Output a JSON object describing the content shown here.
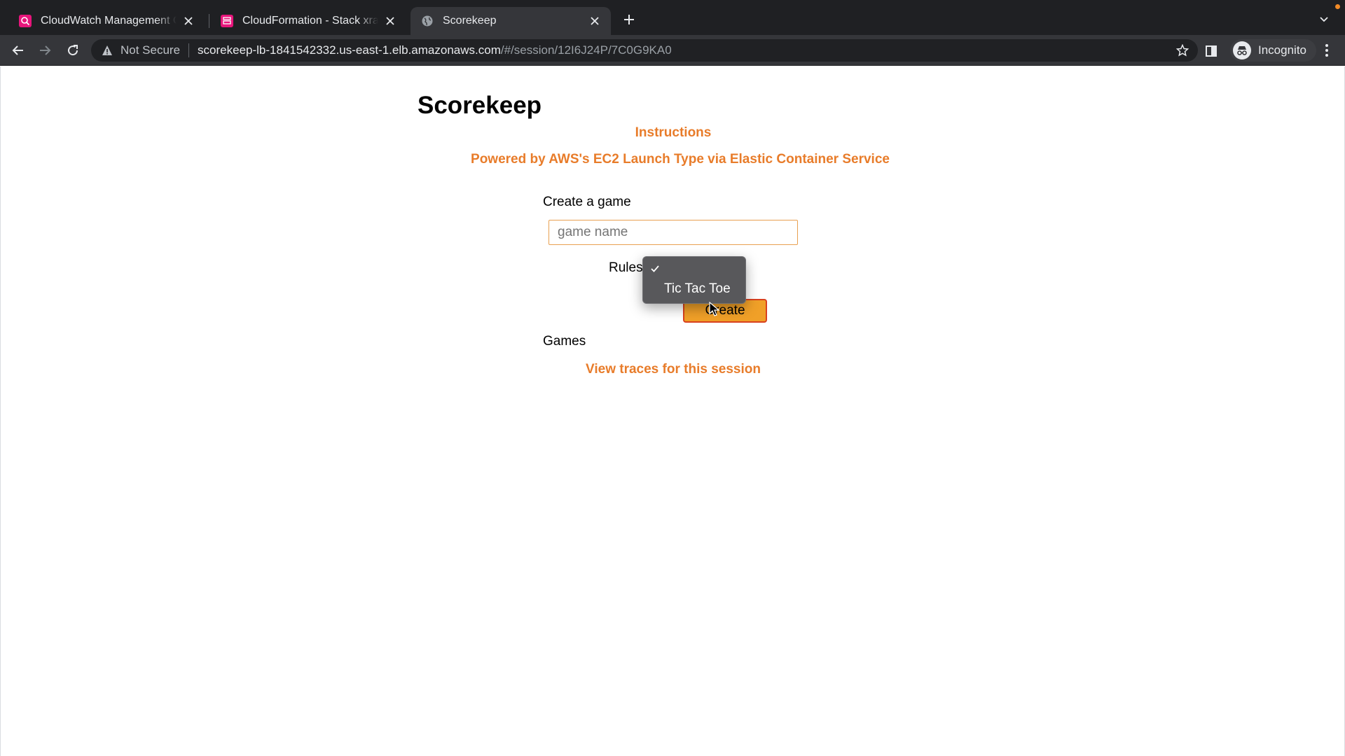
{
  "browser": {
    "tabs": [
      {
        "title": "CloudWatch Management Console",
        "active": false,
        "favicon": "cloudwatch-icon",
        "color": "#e7157b"
      },
      {
        "title": "CloudFormation - Stack xray-scorekeep",
        "active": false,
        "favicon": "cloudformation-icon",
        "color": "#e7157b"
      },
      {
        "title": "Scorekeep",
        "active": true,
        "favicon": "globe-icon"
      }
    ],
    "address": {
      "security_label": "Not Secure",
      "host": "scorekeep-lb-1841542332.us-east-1.elb.amazonaws.com",
      "path": "/#/session/12I6J24P/7C0G9KA0"
    },
    "profile_label": "Incognito"
  },
  "page": {
    "title": "Scorekeep",
    "instructions_link": "Instructions",
    "powered_by_link": "Powered by AWS's EC2 Launch Type via Elastic Container Service",
    "create_game_label": "Create a game",
    "game_name_placeholder": "game name",
    "rules_label": "Rules",
    "rules_options": [
      {
        "label": "",
        "selected": true
      },
      {
        "label": "Tic Tac Toe",
        "selected": false
      }
    ],
    "create_button": "Create",
    "games_label": "Games",
    "traces_link": "View traces for this session"
  },
  "colors": {
    "accent_orange": "#e87c2a",
    "button_fill": "#f0a028",
    "button_border": "#d9411e"
  }
}
